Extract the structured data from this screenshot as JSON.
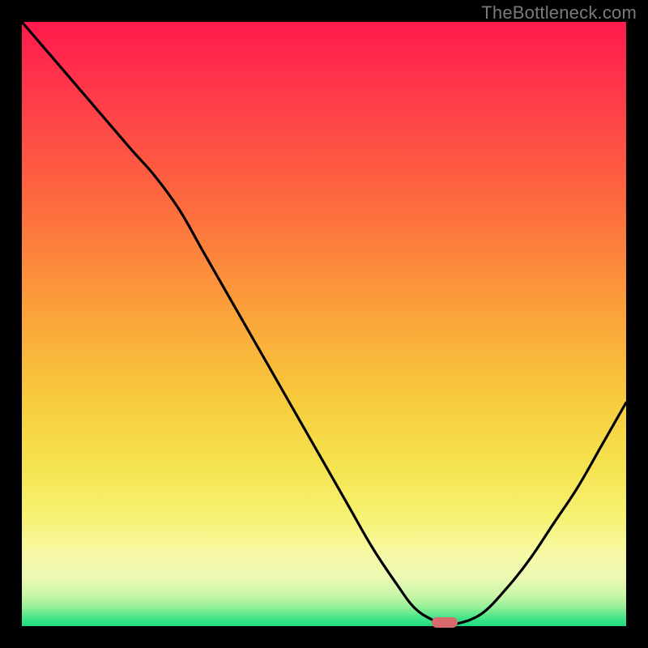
{
  "watermark": "TheBottleneck.com",
  "colors": {
    "gradient_top": "#ff1a4d",
    "gradient_mid": "#f7cc3d",
    "gradient_bottom": "#1ddc82",
    "curve": "#000000",
    "marker": "#d86a6e",
    "frame": "#000000"
  },
  "chart_data": {
    "type": "line",
    "title": "",
    "xlabel": "",
    "ylabel": "",
    "xlim": [
      0,
      100
    ],
    "ylim": [
      0,
      100
    ],
    "x": [
      0,
      6,
      12,
      18,
      22,
      26,
      30,
      34,
      38,
      42,
      46,
      50,
      54,
      58,
      62,
      65,
      68,
      70,
      72,
      76,
      80,
      84,
      88,
      92,
      96,
      100
    ],
    "values": [
      100,
      93,
      86,
      79,
      74.5,
      69,
      62,
      55,
      48,
      41,
      34,
      27,
      20,
      13,
      7,
      3,
      1,
      0.4,
      0.4,
      2,
      6,
      11,
      17,
      23,
      30,
      37
    ],
    "optimum_x": 70,
    "optimum_y": 0.4,
    "annotations": []
  }
}
